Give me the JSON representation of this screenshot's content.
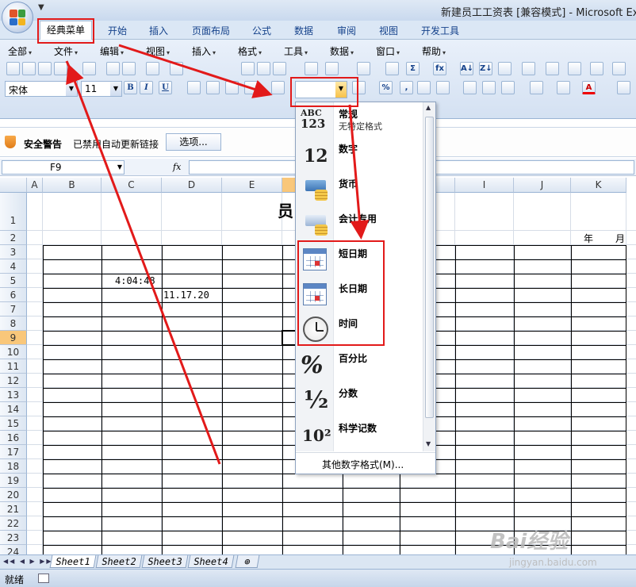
{
  "window": {
    "title": "新建员工工资表  [兼容模式] - Microsoft Exce",
    "qat_glyph": "▼"
  },
  "ribbon_tabs": [
    "经典菜单",
    "开始",
    "插入",
    "页面布局",
    "公式",
    "数据",
    "审阅",
    "视图",
    "开发工具"
  ],
  "classic_menu": [
    "全部",
    "文件",
    "编辑",
    "视图",
    "插入",
    "格式",
    "工具",
    "数据",
    "窗口",
    "帮助"
  ],
  "toolbar": {
    "font_name": "宋体",
    "font_size": "11",
    "bold": "B",
    "italic": "I",
    "underline": "U",
    "number_format_value": "",
    "percent": "%",
    "comma": ",",
    "sum": "Σ",
    "fx": "fx",
    "sort_az": "A↓",
    "sort_za": "Z↓",
    "font_color_letter": "A"
  },
  "security_bar": {
    "label": "安全警告",
    "message": "已禁用自动更新链接",
    "options_button": "选项..."
  },
  "formula_bar": {
    "cell_ref": "F9",
    "fx_label": "fx",
    "content": ""
  },
  "sheet": {
    "columns": [
      "A",
      "B",
      "C",
      "D",
      "E",
      "F",
      "G",
      "H",
      "I",
      "J",
      "K"
    ],
    "rows": [
      "1",
      "2",
      "3",
      "4",
      "5",
      "6",
      "7",
      "8",
      "9",
      "10",
      "11",
      "12",
      "13",
      "14",
      "15",
      "16",
      "17",
      "18",
      "19",
      "20",
      "21",
      "22",
      "23",
      "24"
    ],
    "title_char": "员",
    "year_label": "年",
    "month_label": "月",
    "c5_value": "4:04:48",
    "d6_value": "11.17.20",
    "selected_column": "F",
    "selected_row": "9"
  },
  "number_format_dropdown": {
    "items": [
      {
        "icon": "abc-123-icon",
        "label": "常规",
        "sub": "无特定格式"
      },
      {
        "icon": "number-12-icon",
        "label": "数字",
        "sub": ""
      },
      {
        "icon": "currency-icon",
        "label": "货币",
        "sub": ""
      },
      {
        "icon": "accounting-icon",
        "label": "会计专用",
        "sub": ""
      },
      {
        "icon": "calendar-icon",
        "label": "短日期",
        "sub": ""
      },
      {
        "icon": "calendar-icon",
        "label": "长日期",
        "sub": ""
      },
      {
        "icon": "clock-icon",
        "label": "时间",
        "sub": ""
      },
      {
        "icon": "percent-icon",
        "label": "百分比",
        "sub": ""
      },
      {
        "icon": "fraction-icon",
        "label": "分数",
        "sub": ""
      },
      {
        "icon": "scientific-icon",
        "label": "科学记数",
        "sub": ""
      }
    ],
    "icon_glyphs": {
      "abc_top": "ABC",
      "abc_bottom": "123",
      "twelve": "12",
      "percent": "%",
      "fraction": "½",
      "sci": "10²"
    },
    "more_formats": "其他数字格式(M)..."
  },
  "sheet_tabs": [
    "Sheet1",
    "Sheet2",
    "Sheet3",
    "Sheet4"
  ],
  "status": {
    "ready": "就绪"
  },
  "watermark": {
    "brand": "Bai经验",
    "url": "jingyan.baidu.com"
  },
  "colors": {
    "annotation_red": "#e21a1a",
    "ribbon_blue": "#15428b",
    "selection_orange": "#f9c77a"
  }
}
